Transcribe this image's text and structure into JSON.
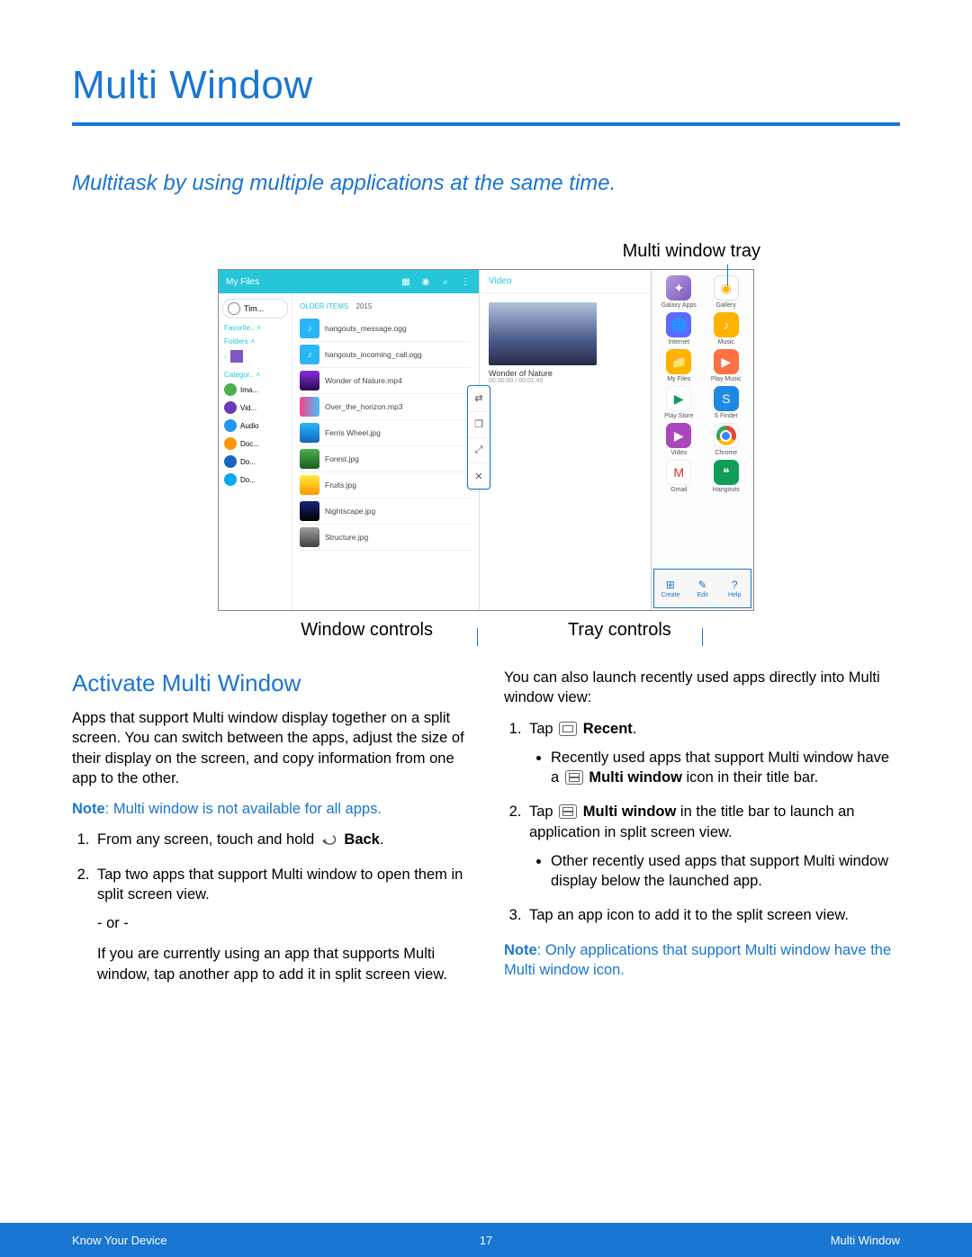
{
  "title": "Multi Window",
  "subtitle": "Multitask by using multiple applications at the same time.",
  "callouts": {
    "top": "Multi window tray",
    "bottom_left": "Window controls",
    "bottom_right": "Tray controls"
  },
  "figure": {
    "left_header": "My Files",
    "mid_header": "Video",
    "sidebar": {
      "top_item": "Tim...",
      "sec_favorite": "Favorite..",
      "sec_folders": "Folders",
      "sec_categor": "Categor..",
      "cat": [
        "Ima...",
        "Vid...",
        "Audio",
        "Doc...",
        "Do...",
        "Do..."
      ]
    },
    "filelist_header": "OLDER ITEMS",
    "filelist_year": "2015",
    "files": [
      "hangouts_message.ogg",
      "hangouts_incoming_call.ogg",
      "Wonder of Nature.mp4",
      "Over_the_horizon.mp3",
      "Ferris Wheel.jpg",
      "Forest.jpg",
      "Fruits.jpg",
      "Nightscape.jpg",
      "Structure.jpg"
    ],
    "video_title": "Wonder of Nature",
    "video_time": "00:00:00 / 00:01:45",
    "tray_apps": [
      [
        "Galaxy Apps",
        "galaxy"
      ],
      [
        "Gallery",
        "gallery"
      ],
      [
        "Internet",
        "internet"
      ],
      [
        "Music",
        "music"
      ],
      [
        "My Files",
        "myfiles"
      ],
      [
        "Play Music",
        "playmusic"
      ],
      [
        "Play Store",
        "playstore"
      ],
      [
        "S Finder",
        "sfinder"
      ],
      [
        "Video",
        "video"
      ],
      [
        "Chrome",
        "chrome"
      ],
      [
        "Gmail",
        "gmail"
      ],
      [
        "Hangouts",
        "hangouts"
      ]
    ],
    "tray_ctrl": [
      "Create",
      "Edit",
      "Help"
    ]
  },
  "section_heading": "Activate Multi Window",
  "left_col": {
    "p1": "Apps that support Multi window display together on a split screen. You can switch between the apps, adjust the size of their display on the screen, and copy information from one app to the other.",
    "note_label": "Note",
    "note_text": ": Multi window is not available for all apps.",
    "li1_pre": "From any screen, touch and hold ",
    "li1_bold": "Back",
    "li1_post": ".",
    "li2": "Tap two apps that support Multi window to open them in split screen view.",
    "or": "- or -",
    "li2b": "If you are currently using an app that supports Multi window, tap another app to add it in split screen view."
  },
  "right_col": {
    "p1": "You can also launch recently used apps directly into Multi window view:",
    "li1_pre": "Tap ",
    "li1_bold": "Recent",
    "li1_post": ".",
    "li1_sub_pre": "Recently used apps that support Multi window have a ",
    "li1_sub_bold": "Multi window",
    "li1_sub_post": " icon in their title bar.",
    "li2_pre": "Tap ",
    "li2_bold": "Multi window",
    "li2_post": " in the title bar to launch an application in split screen view.",
    "li2_sub": "Other recently used apps that support Multi window display below the launched app.",
    "li3": "Tap an app icon to add it to the split screen view.",
    "note_label": "Note",
    "note_text": ": Only applications that support Multi window have the Multi window icon."
  },
  "footer": {
    "left": "Know Your Device",
    "center": "17",
    "right": "Multi Window"
  }
}
